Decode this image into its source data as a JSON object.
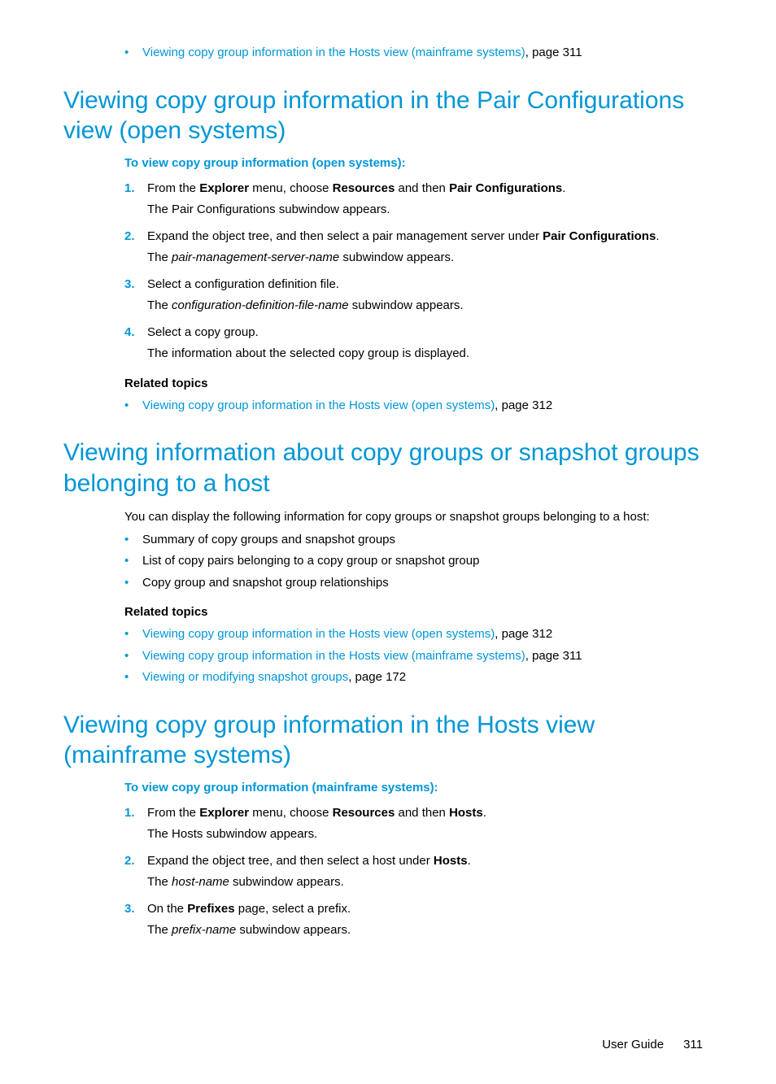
{
  "top_bullet": {
    "link": "Viewing copy group information in the Hosts view (mainframe systems)",
    "suffix": ", page 311"
  },
  "section1": {
    "heading": "Viewing copy group information in the Pair Configurations view (open systems)",
    "intro": "To view copy group information (open systems):",
    "steps": [
      {
        "num": "1.",
        "parts": [
          "From the ",
          "Explorer",
          " menu, choose ",
          "Resources",
          " and then ",
          "Pair Configurations",
          "."
        ],
        "bold_idx": [
          1,
          3,
          5
        ],
        "sub": "The Pair Configurations subwindow appears."
      },
      {
        "num": "2.",
        "parts": [
          "Expand the object tree, and then select a pair management server under ",
          "Pair Configurations",
          "."
        ],
        "bold_idx": [
          1
        ],
        "sub_parts": [
          "The ",
          "pair-management-server-name",
          " subwindow appears."
        ],
        "sub_italic_idx": [
          1
        ]
      },
      {
        "num": "3.",
        "parts": [
          "Select a configuration definition file."
        ],
        "bold_idx": [],
        "sub_parts": [
          "The ",
          "configuration-definition-file-name",
          " subwindow appears."
        ],
        "sub_italic_idx": [
          1
        ]
      },
      {
        "num": "4.",
        "parts": [
          "Select a copy group."
        ],
        "bold_idx": [],
        "sub": "The information about the selected copy group is displayed."
      }
    ],
    "related_heading": "Related topics",
    "related": [
      {
        "link": "Viewing copy group information in the Hosts view (open systems)",
        "suffix": ", page 312"
      }
    ]
  },
  "section2": {
    "heading": "Viewing information about copy groups or snapshot groups belonging to a host",
    "para": "You can display the following information for copy groups or snapshot groups belonging to a host:",
    "bullets": [
      "Summary of copy groups and snapshot groups",
      "List of copy pairs belonging to a copy group or snapshot group",
      "Copy group and snapshot group relationships"
    ],
    "related_heading": "Related topics",
    "related": [
      {
        "link": "Viewing copy group information in the Hosts view (open systems)",
        "suffix": ", page 312"
      },
      {
        "link": "Viewing copy group information in the Hosts view (mainframe systems)",
        "suffix": ", page 311"
      },
      {
        "link": "Viewing or modifying snapshot groups",
        "suffix": ", page 172"
      }
    ]
  },
  "section3": {
    "heading": "Viewing copy group information in the Hosts view (mainframe systems)",
    "intro": "To view copy group information (mainframe systems):",
    "steps": [
      {
        "num": "1.",
        "parts": [
          "From the ",
          "Explorer",
          " menu, choose ",
          "Resources",
          " and then ",
          "Hosts",
          "."
        ],
        "bold_idx": [
          1,
          3,
          5
        ],
        "sub": "The Hosts subwindow appears."
      },
      {
        "num": "2.",
        "parts": [
          "Expand the object tree, and then select a host under ",
          "Hosts",
          "."
        ],
        "bold_idx": [
          1
        ],
        "sub_parts": [
          "The ",
          "host-name",
          " subwindow appears."
        ],
        "sub_italic_idx": [
          1
        ]
      },
      {
        "num": "3.",
        "parts": [
          "On the ",
          "Prefixes",
          " page, select a prefix."
        ],
        "bold_idx": [
          1
        ],
        "sub_parts": [
          "The ",
          "prefix-name",
          " subwindow appears."
        ],
        "sub_italic_idx": [
          1
        ]
      }
    ]
  },
  "footer": {
    "label": "User Guide",
    "page": "311"
  }
}
